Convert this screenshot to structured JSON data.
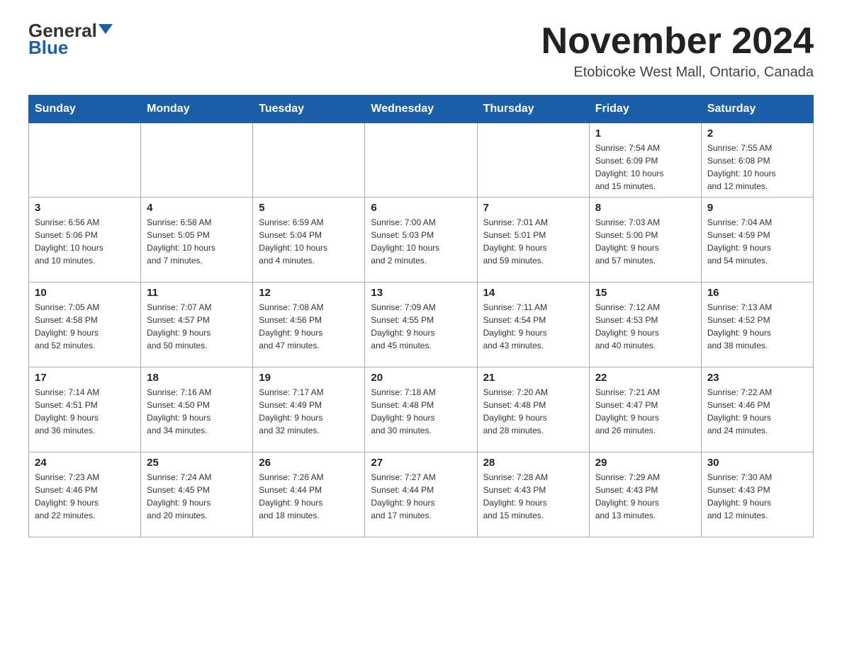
{
  "header": {
    "logo_line1": "General",
    "logo_line2": "Blue",
    "title": "November 2024",
    "subtitle": "Etobicoke West Mall, Ontario, Canada"
  },
  "days_of_week": [
    "Sunday",
    "Monday",
    "Tuesday",
    "Wednesday",
    "Thursday",
    "Friday",
    "Saturday"
  ],
  "weeks": [
    {
      "days": [
        {
          "num": "",
          "info": ""
        },
        {
          "num": "",
          "info": ""
        },
        {
          "num": "",
          "info": ""
        },
        {
          "num": "",
          "info": ""
        },
        {
          "num": "",
          "info": ""
        },
        {
          "num": "1",
          "info": "Sunrise: 7:54 AM\nSunset: 6:09 PM\nDaylight: 10 hours\nand 15 minutes."
        },
        {
          "num": "2",
          "info": "Sunrise: 7:55 AM\nSunset: 6:08 PM\nDaylight: 10 hours\nand 12 minutes."
        }
      ]
    },
    {
      "days": [
        {
          "num": "3",
          "info": "Sunrise: 6:56 AM\nSunset: 5:06 PM\nDaylight: 10 hours\nand 10 minutes."
        },
        {
          "num": "4",
          "info": "Sunrise: 6:58 AM\nSunset: 5:05 PM\nDaylight: 10 hours\nand 7 minutes."
        },
        {
          "num": "5",
          "info": "Sunrise: 6:59 AM\nSunset: 5:04 PM\nDaylight: 10 hours\nand 4 minutes."
        },
        {
          "num": "6",
          "info": "Sunrise: 7:00 AM\nSunset: 5:03 PM\nDaylight: 10 hours\nand 2 minutes."
        },
        {
          "num": "7",
          "info": "Sunrise: 7:01 AM\nSunset: 5:01 PM\nDaylight: 9 hours\nand 59 minutes."
        },
        {
          "num": "8",
          "info": "Sunrise: 7:03 AM\nSunset: 5:00 PM\nDaylight: 9 hours\nand 57 minutes."
        },
        {
          "num": "9",
          "info": "Sunrise: 7:04 AM\nSunset: 4:59 PM\nDaylight: 9 hours\nand 54 minutes."
        }
      ]
    },
    {
      "days": [
        {
          "num": "10",
          "info": "Sunrise: 7:05 AM\nSunset: 4:58 PM\nDaylight: 9 hours\nand 52 minutes."
        },
        {
          "num": "11",
          "info": "Sunrise: 7:07 AM\nSunset: 4:57 PM\nDaylight: 9 hours\nand 50 minutes."
        },
        {
          "num": "12",
          "info": "Sunrise: 7:08 AM\nSunset: 4:56 PM\nDaylight: 9 hours\nand 47 minutes."
        },
        {
          "num": "13",
          "info": "Sunrise: 7:09 AM\nSunset: 4:55 PM\nDaylight: 9 hours\nand 45 minutes."
        },
        {
          "num": "14",
          "info": "Sunrise: 7:11 AM\nSunset: 4:54 PM\nDaylight: 9 hours\nand 43 minutes."
        },
        {
          "num": "15",
          "info": "Sunrise: 7:12 AM\nSunset: 4:53 PM\nDaylight: 9 hours\nand 40 minutes."
        },
        {
          "num": "16",
          "info": "Sunrise: 7:13 AM\nSunset: 4:52 PM\nDaylight: 9 hours\nand 38 minutes."
        }
      ]
    },
    {
      "days": [
        {
          "num": "17",
          "info": "Sunrise: 7:14 AM\nSunset: 4:51 PM\nDaylight: 9 hours\nand 36 minutes."
        },
        {
          "num": "18",
          "info": "Sunrise: 7:16 AM\nSunset: 4:50 PM\nDaylight: 9 hours\nand 34 minutes."
        },
        {
          "num": "19",
          "info": "Sunrise: 7:17 AM\nSunset: 4:49 PM\nDaylight: 9 hours\nand 32 minutes."
        },
        {
          "num": "20",
          "info": "Sunrise: 7:18 AM\nSunset: 4:48 PM\nDaylight: 9 hours\nand 30 minutes."
        },
        {
          "num": "21",
          "info": "Sunrise: 7:20 AM\nSunset: 4:48 PM\nDaylight: 9 hours\nand 28 minutes."
        },
        {
          "num": "22",
          "info": "Sunrise: 7:21 AM\nSunset: 4:47 PM\nDaylight: 9 hours\nand 26 minutes."
        },
        {
          "num": "23",
          "info": "Sunrise: 7:22 AM\nSunset: 4:46 PM\nDaylight: 9 hours\nand 24 minutes."
        }
      ]
    },
    {
      "days": [
        {
          "num": "24",
          "info": "Sunrise: 7:23 AM\nSunset: 4:46 PM\nDaylight: 9 hours\nand 22 minutes."
        },
        {
          "num": "25",
          "info": "Sunrise: 7:24 AM\nSunset: 4:45 PM\nDaylight: 9 hours\nand 20 minutes."
        },
        {
          "num": "26",
          "info": "Sunrise: 7:26 AM\nSunset: 4:44 PM\nDaylight: 9 hours\nand 18 minutes."
        },
        {
          "num": "27",
          "info": "Sunrise: 7:27 AM\nSunset: 4:44 PM\nDaylight: 9 hours\nand 17 minutes."
        },
        {
          "num": "28",
          "info": "Sunrise: 7:28 AM\nSunset: 4:43 PM\nDaylight: 9 hours\nand 15 minutes."
        },
        {
          "num": "29",
          "info": "Sunrise: 7:29 AM\nSunset: 4:43 PM\nDaylight: 9 hours\nand 13 minutes."
        },
        {
          "num": "30",
          "info": "Sunrise: 7:30 AM\nSunset: 4:43 PM\nDaylight: 9 hours\nand 12 minutes."
        }
      ]
    }
  ]
}
